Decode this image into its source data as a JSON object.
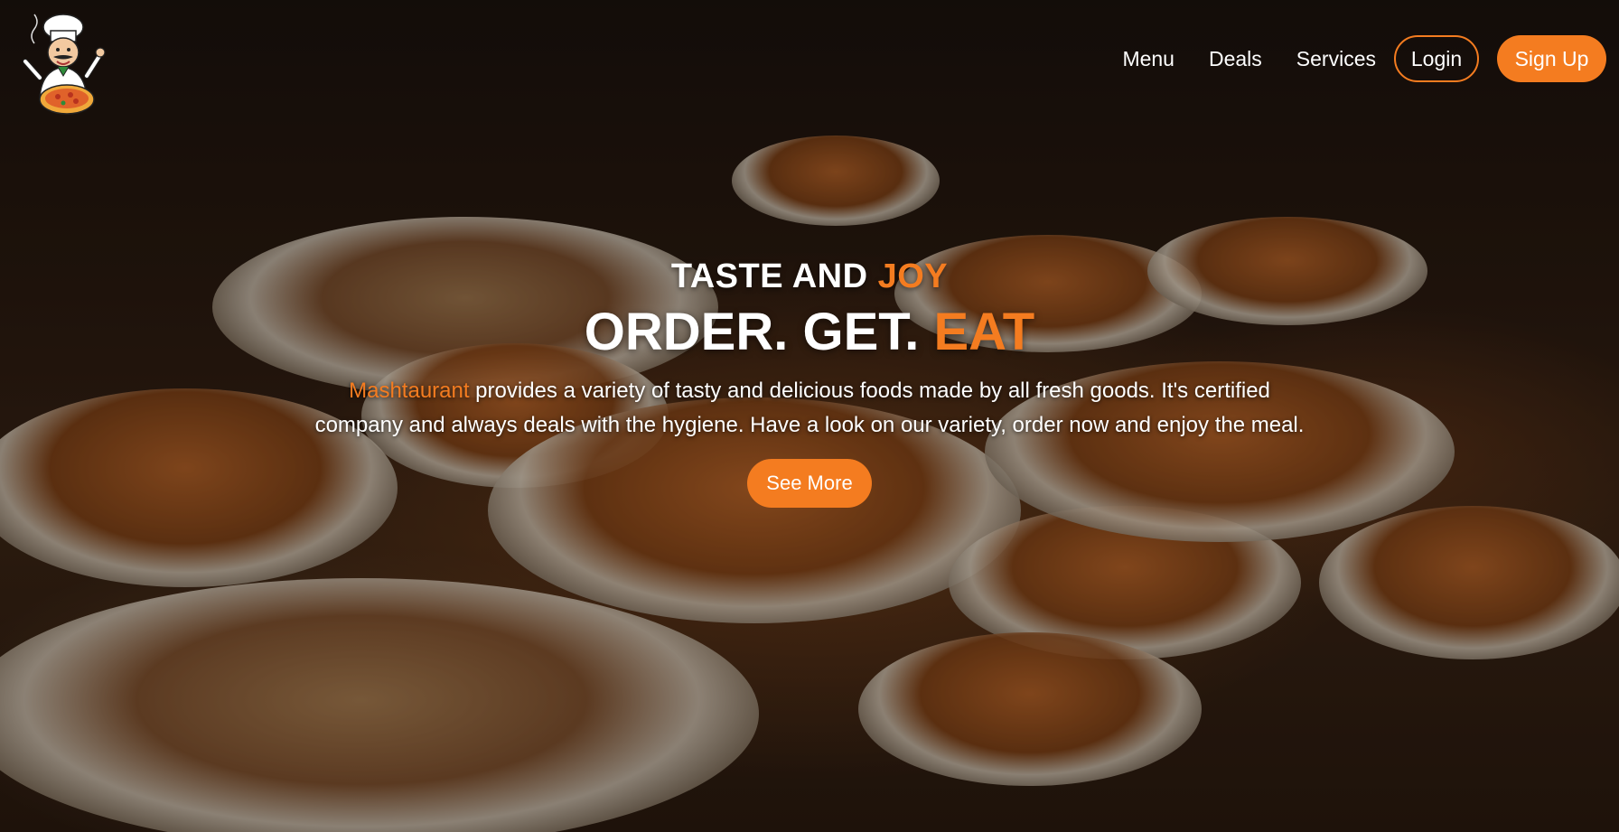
{
  "brand": {
    "name": "Mashtaurant",
    "accent_color": "#f47c20",
    "logo_icon": "chef-with-pizza-logo"
  },
  "nav": {
    "links": [
      "Menu",
      "Deals",
      "Services"
    ],
    "login_label": "Login",
    "signup_label": "Sign Up"
  },
  "hero": {
    "kicker_white": "TASTE AND ",
    "kicker_accent": "JOY",
    "headline_white": "ORDER. GET. ",
    "headline_accent": "EAT",
    "description_brand": "Mashtaurant",
    "description_rest": " provides a variety of tasty and delicious foods made by all fresh goods. It's certified company and always deals with the hygiene. Have a look on our variety, order now and enjoy the meal.",
    "cta_label": "See More"
  }
}
